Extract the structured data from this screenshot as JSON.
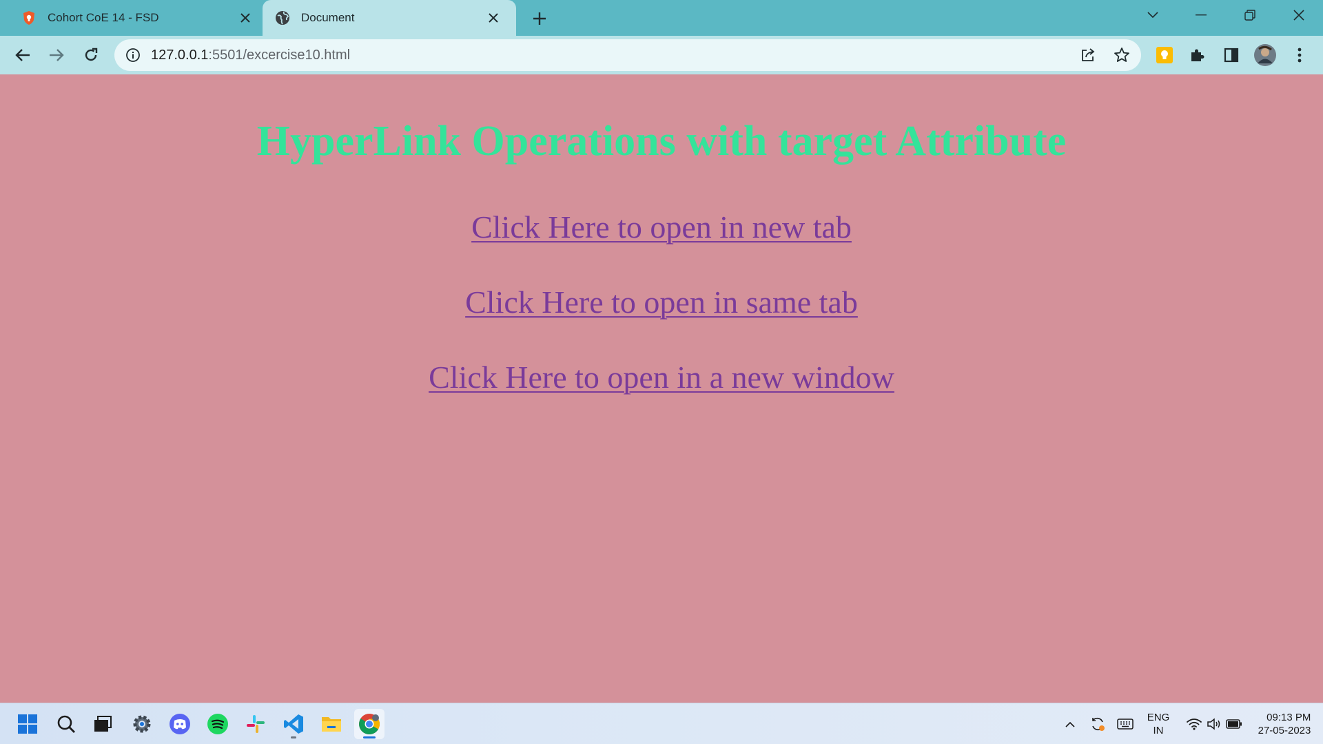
{
  "browser": {
    "tabs": [
      {
        "title": "Cohort CoE 14 - FSD",
        "icon": "shield-favicon-icon"
      },
      {
        "title": "Document",
        "icon": "globe-favicon-icon"
      }
    ],
    "address": {
      "host": "127.0.0.1",
      "rest": ":5501/excercise10.html"
    }
  },
  "page": {
    "heading": "HyperLink Operations with target Attribute",
    "links": [
      "Click Here to open in new tab",
      "Click Here to open in same tab",
      "Click Here to open in a new window"
    ]
  },
  "taskbar": {
    "language": {
      "line1": "ENG",
      "line2": "IN"
    },
    "clock": {
      "time": "09:13 PM",
      "date": "27-05-2023"
    }
  },
  "colors": {
    "page_background": "#d4919a",
    "heading": "#34e39a",
    "link": "#7a3b9a",
    "tabstrip": "#5bb8c4",
    "active_tab": "#b9e3e8"
  }
}
